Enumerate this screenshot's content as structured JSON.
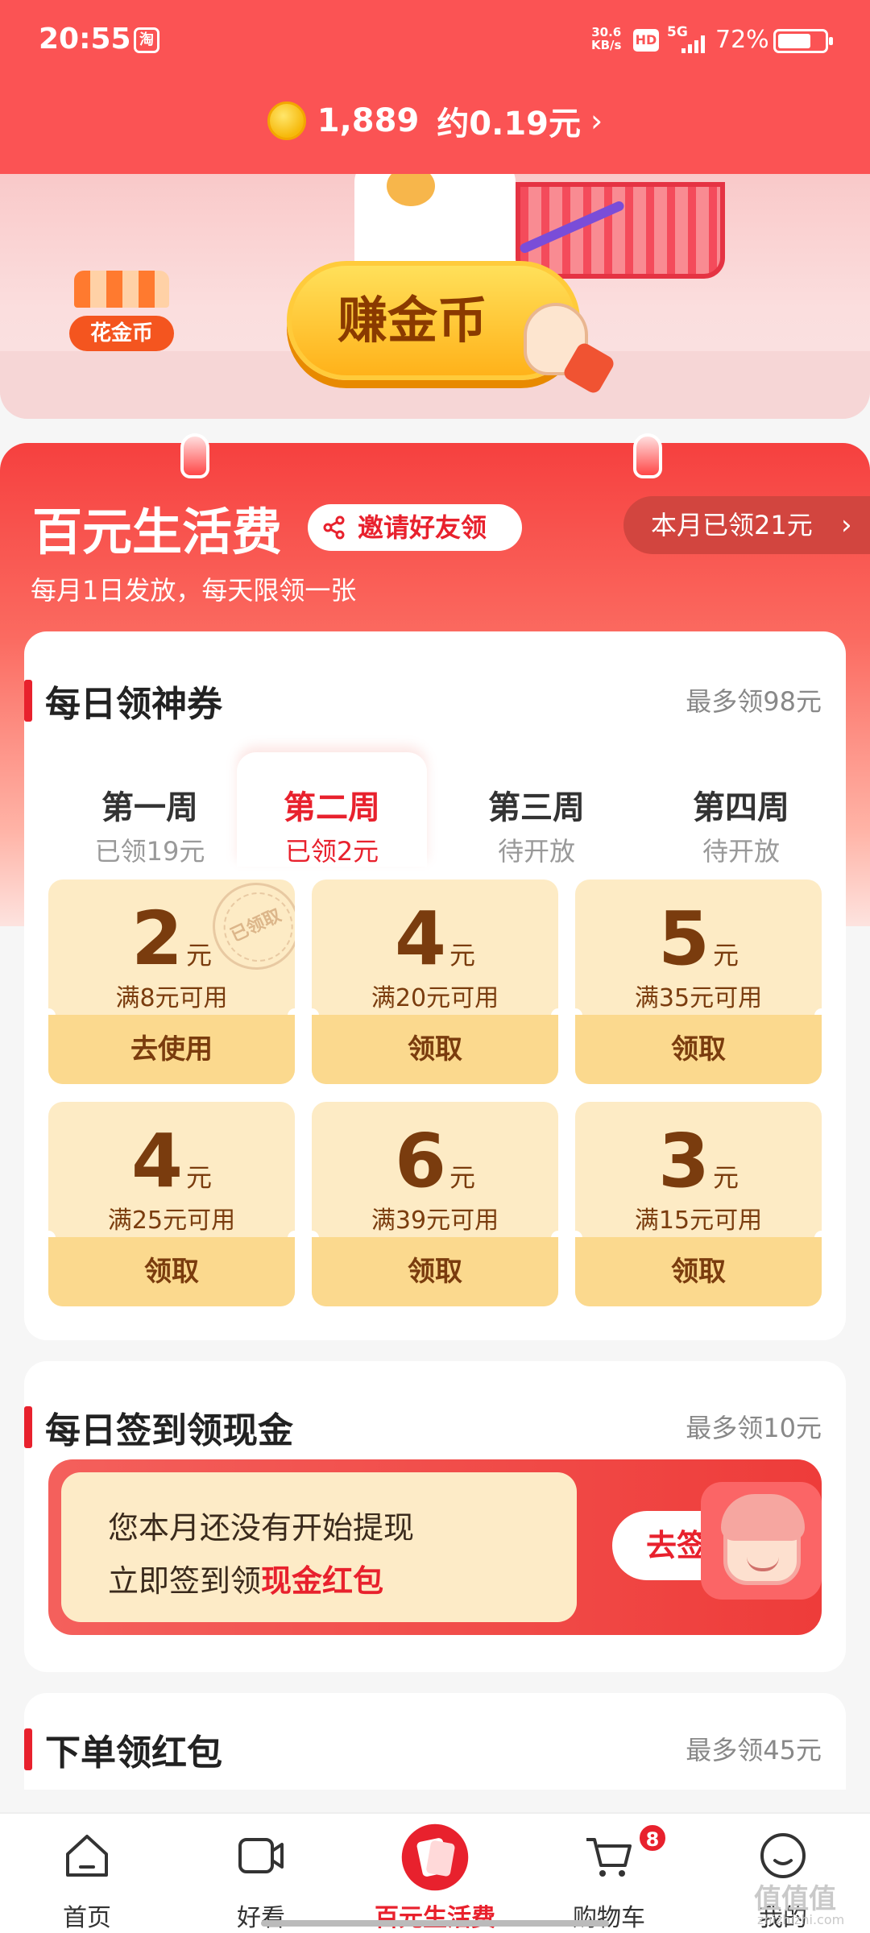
{
  "status_bar": {
    "time": "20:55",
    "app_icon": "淘",
    "net_speed_top": "30.6",
    "net_speed_bottom": "KB/s",
    "hd": "HD",
    "signal": "5G",
    "battery": "72%",
    "battery_level": 0.72
  },
  "header": {
    "coins": "1,889",
    "approx": "约0.19元",
    "chevron": "›"
  },
  "banner": {
    "shop_label": "花金币",
    "earn_button": "赚金币"
  },
  "section": {
    "title": "百元生活费",
    "invite_label": "邀请好友领",
    "claimed_label": "本月已领21元",
    "claimed_chevron": "›",
    "subtitle": "每月1日发放，每天限领一张"
  },
  "daily_coupons": {
    "title": "每日领神券",
    "max": "最多领98元",
    "weeks": [
      {
        "label": "第一周",
        "status": "已领19元"
      },
      {
        "label": "第二周",
        "status": "已领2元"
      },
      {
        "label": "第三周",
        "status": "待开放"
      },
      {
        "label": "第四周",
        "status": "待开放"
      }
    ],
    "coupons": [
      {
        "amount": "2",
        "unit": "元",
        "condition": "满8元可用",
        "action": "去使用"
      },
      {
        "amount": "4",
        "unit": "元",
        "condition": "满20元可用",
        "action": "领取"
      },
      {
        "amount": "5",
        "unit": "元",
        "condition": "满35元可用",
        "action": "领取"
      },
      {
        "amount": "4",
        "unit": "元",
        "condition": "满25元可用",
        "action": "领取"
      },
      {
        "amount": "6",
        "unit": "元",
        "condition": "满39元可用",
        "action": "领取"
      },
      {
        "amount": "3",
        "unit": "元",
        "condition": "满15元可用",
        "action": "领取"
      }
    ],
    "stamp": "已领取"
  },
  "signin": {
    "title": "每日签到领现金",
    "max": "最多领10元",
    "line1": "您本月还没有开始提现",
    "line2_prefix": "立即签到领",
    "line2_highlight": "现金红包",
    "button": "去签"
  },
  "order": {
    "title": "下单领红包",
    "max": "最多领45元"
  },
  "nav": {
    "items": [
      {
        "label": "首页",
        "icon": "home-icon"
      },
      {
        "label": "好看",
        "icon": "video-icon"
      },
      {
        "label": "百元生活费",
        "icon": "red-packet-icon"
      },
      {
        "label": "购物车",
        "icon": "cart-icon"
      },
      {
        "label": "我的",
        "icon": "profile-icon"
      }
    ],
    "cart_badge": "8"
  },
  "watermark": {
    "main": "值值值",
    "sub": "zhizhizhi.com"
  },
  "colors": {
    "accent": "#e8212d",
    "header": "#fb5354",
    "coupon_bg": "#fdebc5"
  }
}
